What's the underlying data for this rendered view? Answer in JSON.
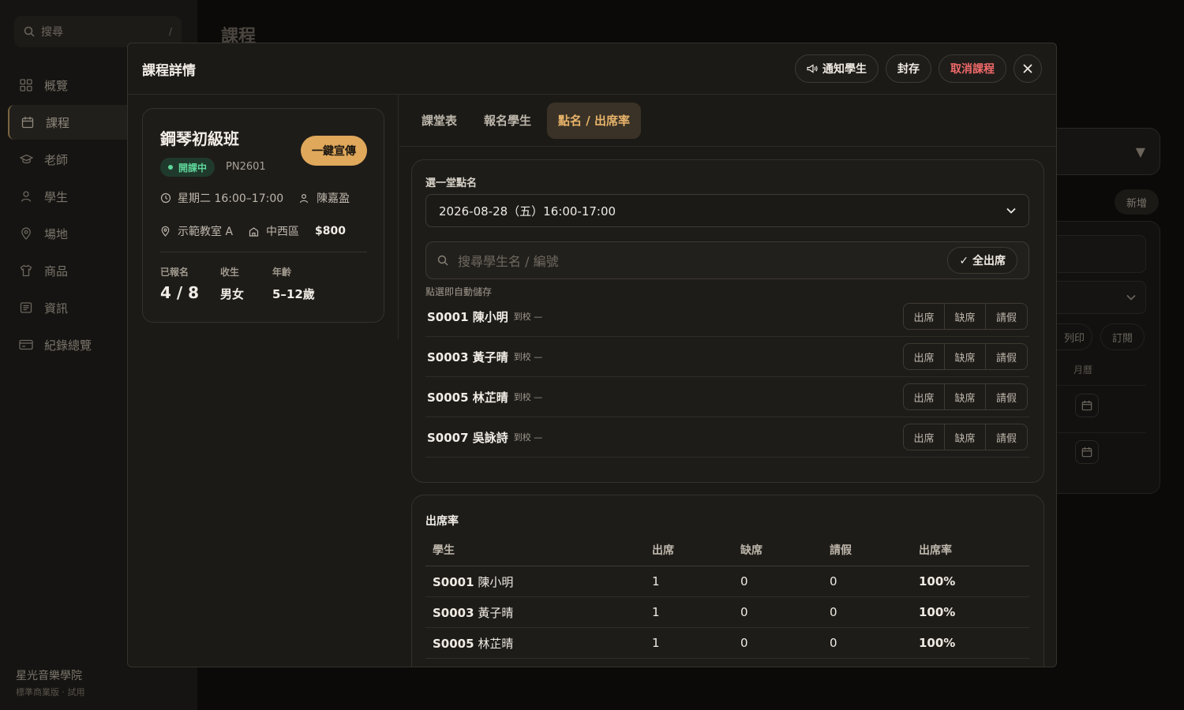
{
  "sidebar": {
    "search_placeholder": "搜尋",
    "search_shortcut": "/",
    "items": [
      {
        "label": "概覽",
        "icon": "grid-icon"
      },
      {
        "label": "課程",
        "icon": "calendar-icon"
      },
      {
        "label": "老師",
        "icon": "graduation-cap-icon"
      },
      {
        "label": "學生",
        "icon": "user-icon"
      },
      {
        "label": "場地",
        "icon": "map-pin-icon"
      },
      {
        "label": "商品",
        "icon": "shirt-icon"
      },
      {
        "label": "資訊",
        "icon": "document-icon"
      },
      {
        "label": "紀錄總覽",
        "icon": "card-icon"
      }
    ],
    "active_index": 1,
    "brand_name": "星光音樂學院",
    "brand_plan": "標準商業版 · 試用"
  },
  "background": {
    "page_title": "課程",
    "dropdown_caret": "▼",
    "add_label": "新增",
    "print_label": "列印",
    "subscribe_label": "訂閱",
    "month_label": "月曆"
  },
  "modal": {
    "title": "課程詳情",
    "notify_label": "通知學生",
    "archive_label": "封存",
    "cancel_course_label": "取消課程",
    "course": {
      "name": "鋼琴初級班",
      "promo_label": "一鍵宣傳",
      "status": "開課中",
      "code": "PN2601",
      "schedule": "星期二 16:00–17:00",
      "teacher": "陳嘉盈",
      "room": "示範教室 A",
      "district": "中西區",
      "price": "$800",
      "stats": [
        {
          "label": "已報名",
          "value": "4 / 8"
        },
        {
          "label": "收生",
          "value": "男女"
        },
        {
          "label": "年齡",
          "value": "5–12歲"
        }
      ]
    },
    "tabs": [
      "課堂表",
      "報名學生",
      "點名 / 出席率"
    ],
    "active_tab": 2,
    "attendance": {
      "select_label": "選一堂點名",
      "selected_session": "2026-08-28（五）16:00-17:00",
      "search_placeholder": "搜尋學生名 / 編號",
      "all_present_label": "✓ 全出席",
      "autosave_note": "點選即自動儲存",
      "arrival_label": "到校 —",
      "options": [
        "出席",
        "缺席",
        "請假"
      ],
      "students": [
        "S0001 陳小明",
        "S0003 黃子晴",
        "S0005 林芷晴",
        "S0007 吳詠詩"
      ]
    },
    "rate": {
      "title": "出席率",
      "headers": [
        "學生",
        "出席",
        "缺席",
        "請假",
        "出席率"
      ],
      "rows": [
        {
          "id": "S0001",
          "name": "陳小明",
          "present": "1",
          "absent": "0",
          "leave": "0",
          "rate": "100%"
        },
        {
          "id": "S0003",
          "name": "黃子晴",
          "present": "1",
          "absent": "0",
          "leave": "0",
          "rate": "100%"
        },
        {
          "id": "S0005",
          "name": "林芷晴",
          "present": "1",
          "absent": "0",
          "leave": "0",
          "rate": "100%"
        }
      ]
    }
  }
}
